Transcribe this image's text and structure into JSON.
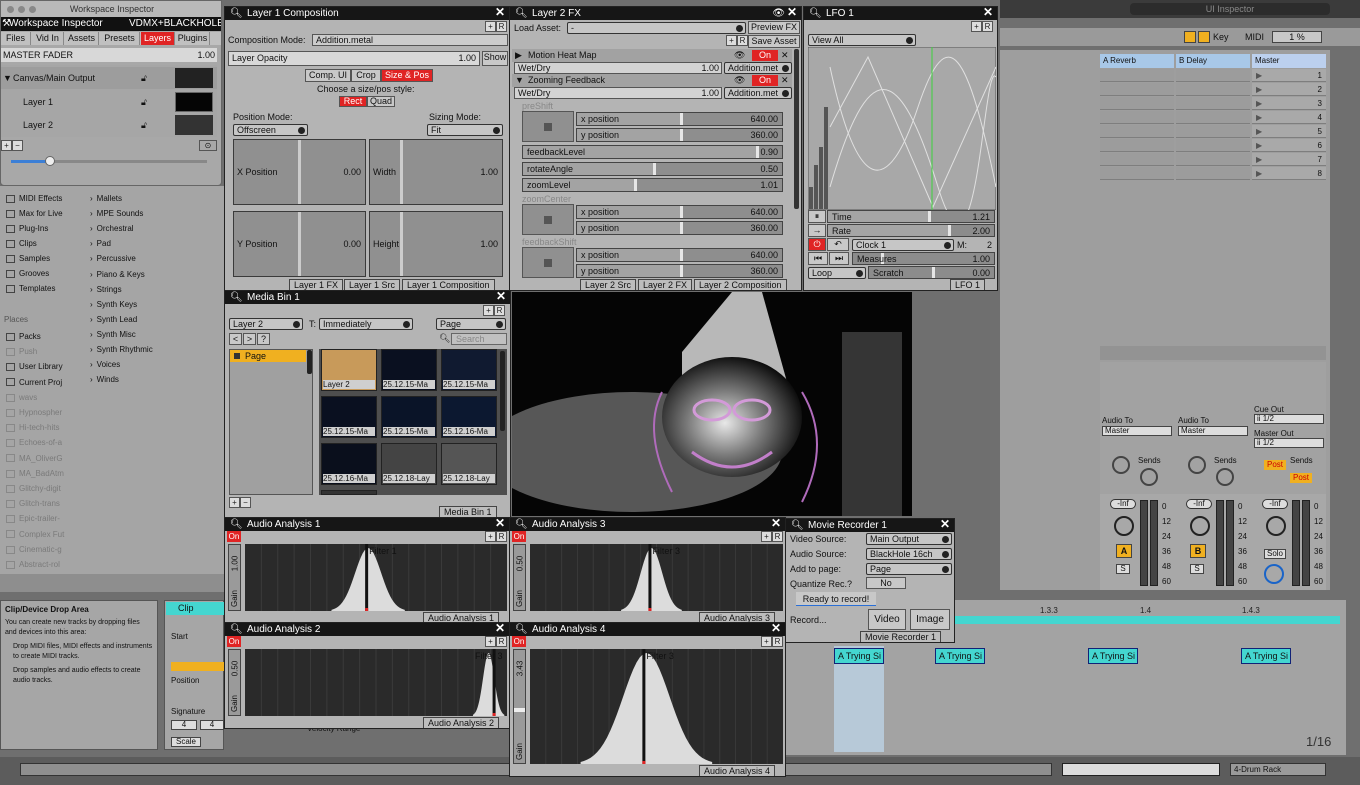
{
  "inspector": {
    "window_title": "Workspace Inspector",
    "title": "Workspace Inspector",
    "project": "VDMX+BLACKHOLE",
    "tabs": [
      "Files",
      "Vid In",
      "Assets",
      "Presets",
      "Layers",
      "Plugins"
    ],
    "active_tab": "Layers",
    "master_label": "MASTER FADER",
    "master_value": "1.00",
    "layers": [
      "Canvas/Main Output",
      "Layer 1",
      "Layer 2"
    ],
    "slider_level": 0.2
  },
  "ui_inspector": {
    "title": "UI Inspector"
  },
  "layer1": {
    "title": "Layer 1 Composition",
    "mode_label": "Composition Mode:",
    "mode_value": "Addition.metal",
    "opacity_label": "Layer Opacity",
    "opacity_value": "1.00",
    "show_btn": "Show",
    "tabs": [
      "Comp. UI",
      "Crop",
      "Size & Pos"
    ],
    "choose_text": "Choose a size/pos style:",
    "style_rect": "Rect",
    "style_quad": "Quad",
    "pos_mode_label": "Position Mode:",
    "pos_mode_value": "Offscreen",
    "size_mode_label": "Sizing Mode:",
    "size_mode_value": "Fit",
    "x_label": "X Position",
    "x_value": "0.00",
    "w_label": "Width",
    "w_value": "1.00",
    "y_label": "Y Position",
    "y_value": "0.00",
    "h_label": "Height",
    "h_value": "1.00",
    "bottom_tabs": [
      "Layer 1 FX",
      "Layer 1 Src",
      "Layer 1 Composition"
    ]
  },
  "layer2fx": {
    "title": "Layer 2 FX",
    "load_label": "Load Asset:",
    "load_value": "-",
    "preview_btn": "Preview FX",
    "save_btn": "Save Asset",
    "fx": [
      {
        "name": "Motion Heat Map",
        "on": "On",
        "wet_label": "Wet/Dry",
        "wet_value": "1.00",
        "mode": "Addition.met"
      },
      {
        "name": "Zooming Feedback",
        "on": "On",
        "wet_label": "Wet/Dry",
        "wet_value": "1.00",
        "mode": "Addition.met"
      }
    ],
    "sections": [
      "preShift",
      "zoomCenter",
      "feedbackShift"
    ],
    "params": [
      {
        "label": "x position",
        "value": "640.00",
        "level": 0.5
      },
      {
        "label": "y position",
        "value": "360.00",
        "level": 0.5
      },
      {
        "label": "feedbackLevel",
        "value": "0.90",
        "level": 0.9
      },
      {
        "label": "rotateAngle",
        "value": "0.50",
        "level": 0.5
      },
      {
        "label": "zoomLevel",
        "value": "1.01",
        "level": 0.43
      },
      {
        "label": "x position",
        "value": "640.00",
        "level": 0.5
      },
      {
        "label": "y position",
        "value": "360.00",
        "level": 0.5
      },
      {
        "label": "x position",
        "value": "640.00",
        "level": 0.5
      },
      {
        "label": "y position",
        "value": "360.00",
        "level": 0.5
      }
    ],
    "bottom_tabs": [
      "Layer 2 Src",
      "Layer 2 FX",
      "Layer 2 Composition"
    ]
  },
  "lfo": {
    "title": "LFO 1",
    "view_value": "View All",
    "time_label": "Time",
    "time_value": "1.21",
    "rate_label": "Rate",
    "rate_value": "2.00",
    "clock_value": "Clock 1",
    "m_label": "M:",
    "m_value": "2",
    "measures_label": "Measures",
    "measures_value": "1.00",
    "loop_value": "Loop",
    "scratch_label": "Scratch",
    "scratch_value": "0.00",
    "bottom_tab": "LFO 1"
  },
  "mediabin": {
    "title": "Media Bin 1",
    "layer_value": "Layer 2",
    "t_label": "T:",
    "trigger_value": "Immediately",
    "page_value": "Page",
    "search_placeholder": "Search",
    "nav": [
      "<",
      ">",
      "?"
    ],
    "page_item": "Page",
    "thumbs": [
      "Layer 2",
      "25.12.15-Ma",
      "25.12.15-Ma",
      "25.12.15-Ma",
      "25.12.15-Ma",
      "25.12.16-Ma",
      "25.12.16-Ma",
      "25.12.18-Lay",
      "25.12.18-Lay"
    ],
    "bottom_tab": "Media Bin 1"
  },
  "audio": [
    {
      "title": "Audio Analysis 1",
      "filter": "Filter 1",
      "gain": "1.00",
      "gain_label": "Gain",
      "on": "On",
      "tab": "Audio Analysis 1"
    },
    {
      "title": "Audio Analysis 2",
      "filter": "Filter 3",
      "gain": "0.50",
      "gain_label": "Gain",
      "on": "On",
      "tab": "Audio Analysis 2"
    },
    {
      "title": "Audio Analysis 3",
      "filter": "Filter 3",
      "gain": "0.50",
      "gain_label": "Gain",
      "on": "On",
      "tab": "Audio Analysis 3"
    },
    {
      "title": "Audio Analysis 4",
      "filter": "Filter 3",
      "gain": "3.43",
      "gain_label": "Gain",
      "on": "On",
      "tab": "Audio Analysis 4"
    }
  ],
  "recorder": {
    "title": "Movie Recorder 1",
    "video_label": "Video Source:",
    "video_value": "Main Output",
    "audio_label": "Audio Source:",
    "audio_value": "BlackHole 16ch",
    "page_label": "Add to page:",
    "page_value": "Page",
    "quant_label": "Quantize Rec.?",
    "quant_value": "No",
    "status": "Ready to record!",
    "record_label": "Record...",
    "video_btn": "Video",
    "image_btn": "Image",
    "bottom_tab": "Movie Recorder 1"
  },
  "ableton": {
    "key_btn": "Key",
    "midi_btn": "MIDI",
    "zoom": "1 %",
    "tracks": [
      "A Reverb",
      "B Delay",
      "Master"
    ],
    "scene_numbers": [
      "1",
      "2",
      "3",
      "4",
      "5",
      "6",
      "7",
      "8"
    ],
    "audio_to_label": "Audio To",
    "audio_to_value": "Master",
    "cue_out_label": "Cue Out",
    "cue_out_value": "ii 1/2",
    "master_out_label": "Master Out",
    "master_out_value": "ii 1/2",
    "sends_label": "Sends",
    "post_label": "Post",
    "inf_label": "-Inf",
    "track_letters": [
      "A",
      "B"
    ],
    "solo_label": "Solo",
    "s_label": "S",
    "db_marks": [
      "0",
      "12",
      "24",
      "36",
      "48",
      "60"
    ],
    "browser_left": [
      "MIDI Effects",
      "Max for Live",
      "Plug-Ins",
      "Clips",
      "Samples",
      "Grooves",
      "Templates"
    ],
    "browser_places_label": "Places",
    "browser_places": [
      "Packs",
      "Push",
      "User Library",
      "Current Proj",
      "wavs",
      "Hypnospher",
      "Hi-tech-hits",
      "Echoes-of-a",
      "MA_OliverG",
      "MA_BadAtm",
      "Glitchy-digit",
      "Glitch-trans",
      "Epic-trailer-",
      "Complex Fut",
      "Cinematic-g",
      "Abstract-rol"
    ],
    "browser_right": [
      "Mallets",
      "MPE Sounds",
      "Orchestral",
      "Pad",
      "Percussive",
      "Piano & Keys",
      "Strings",
      "Synth Keys",
      "Synth Lead",
      "Synth Misc",
      "Synth Rhythmic",
      "Voices",
      "Winds"
    ],
    "info_title": "Clip/Device Drop Area",
    "info_text": "You can create new tracks by dropping files and devices into this area:",
    "info_bullets": [
      "Drop MIDI files, MIDI effects and instruments to create MIDI tracks.",
      "Drop samples and audio effects to create audio tracks."
    ],
    "clip_header": "Clip",
    "clip_start": "Start",
    "clip_position": "Position",
    "clip_signature": "Signature",
    "sig_num": "4",
    "sig_den": "4",
    "scale_label": "Scale",
    "velocity_label": "Velocity Range",
    "timeline": [
      "1.3.3",
      "1.4",
      "1.4.3"
    ],
    "clips": [
      "A Trying Si",
      "A Trying Si",
      "A Trying Si",
      "A Trying Si"
    ],
    "grid_label": "1/16",
    "drum_rack": "4-Drum Rack"
  }
}
